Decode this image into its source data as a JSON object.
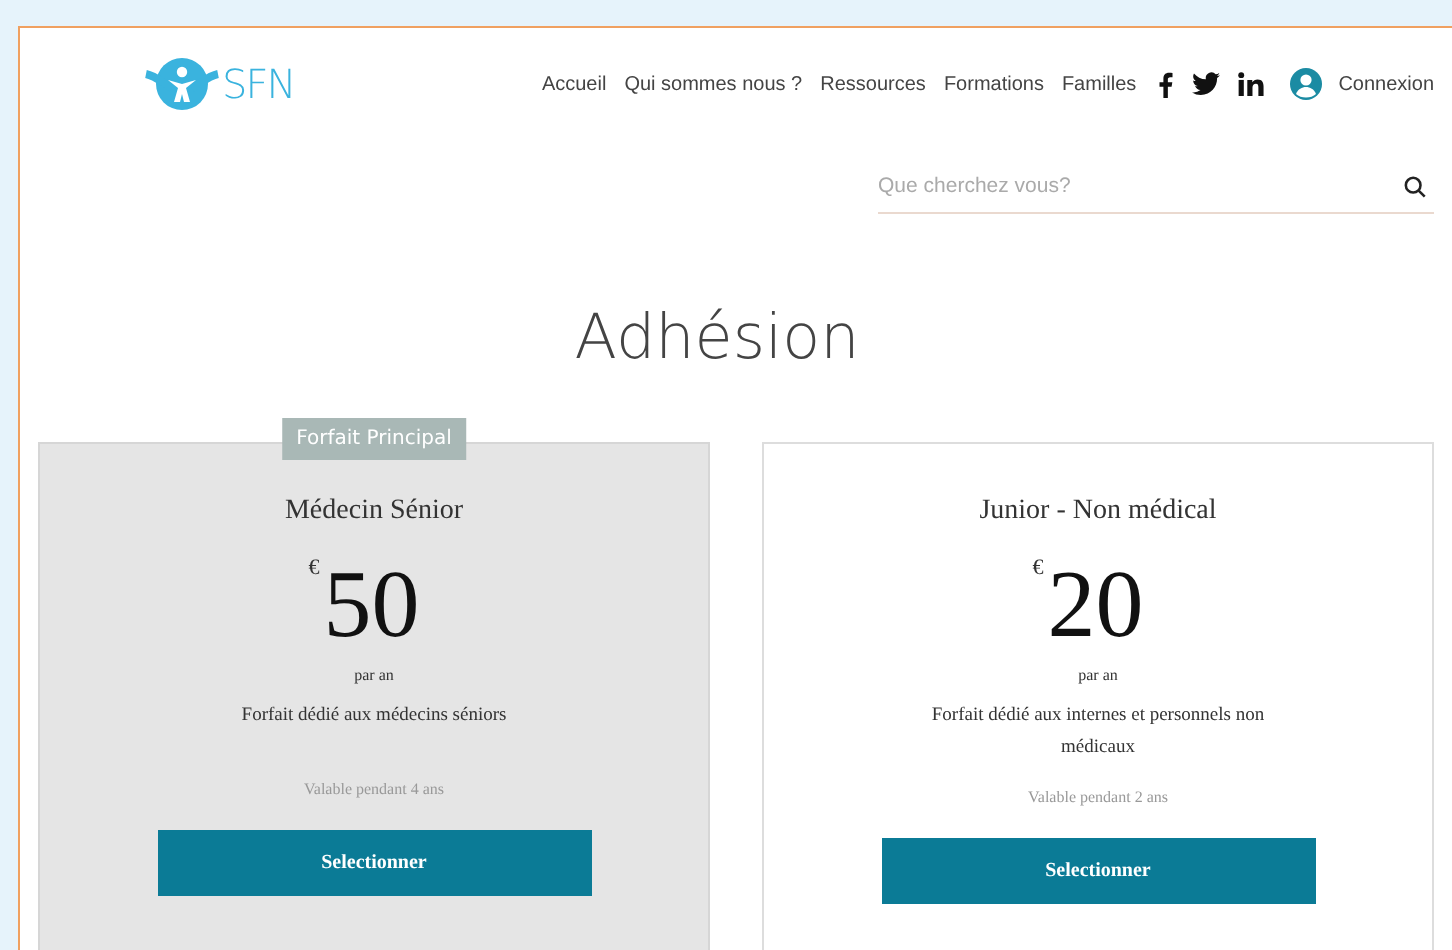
{
  "header": {
    "logo_text": "SFN",
    "nav": [
      {
        "label": "Accueil"
      },
      {
        "label": "Qui sommes nous ?"
      },
      {
        "label": "Ressources"
      },
      {
        "label": "Formations"
      },
      {
        "label": "Familles"
      }
    ],
    "social": [
      {
        "kind": "facebook"
      },
      {
        "kind": "twitter"
      },
      {
        "kind": "linkedin"
      }
    ],
    "login": "Connexion"
  },
  "search": {
    "placeholder": "Que cherchez vous?"
  },
  "title": "Adhésion",
  "plans": [
    {
      "featured": true,
      "badge": "Forfait Principal",
      "name": "Médecin Sénior",
      "currency": "€",
      "price": "50",
      "period": "par an",
      "description": "Forfait dédié aux médecins séniors",
      "validity": "Valable pendant 4 ans",
      "button": "Selectionner"
    },
    {
      "featured": false,
      "name": "Junior - Non médical",
      "currency": "€",
      "price": "20",
      "period": "par an",
      "description": "Forfait dédié aux internes et personnels non médicaux",
      "validity": "Valable pendant 2 ans",
      "button": "Selectionner"
    }
  ]
}
